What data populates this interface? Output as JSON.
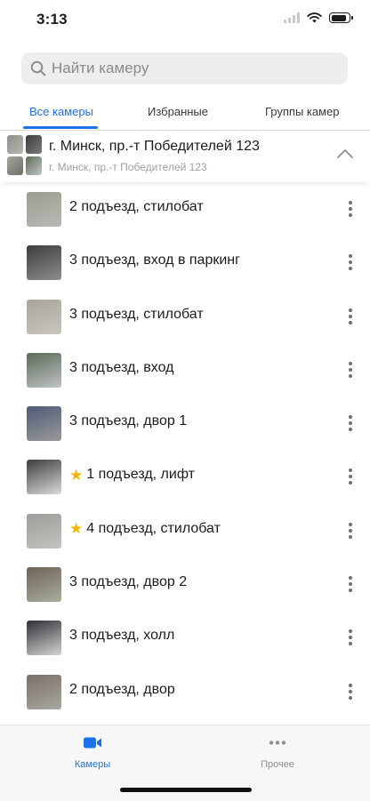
{
  "status_bar": {
    "time": "3:13",
    "battery_level": 0.9
  },
  "search": {
    "placeholder": "Найти камеру",
    "value": ""
  },
  "tabs": [
    {
      "label": "Все камеры",
      "active": true
    },
    {
      "label": "Избранные",
      "active": false
    },
    {
      "label": "Группы камер",
      "active": false
    }
  ],
  "group": {
    "title": "г. Минск, пр.-т Победителей 123",
    "subtitle": "г. Минск, пр.-т Победителей 123",
    "expanded": true
  },
  "cameras": [
    {
      "name": "2 подъезд, стилобат",
      "favorite": false,
      "thumb_colors": [
        "#9b9b94",
        "#b9bab3"
      ]
    },
    {
      "name": "3 подъезд, вход в паркинг",
      "favorite": false,
      "thumb_colors": [
        "#3d3d3f",
        "#8c8d8f"
      ]
    },
    {
      "name": "3 подъезд, стилобат",
      "favorite": false,
      "thumb_colors": [
        "#a8a49c",
        "#c9c6bf"
      ]
    },
    {
      "name": "3 подъезд, вход",
      "favorite": false,
      "thumb_colors": [
        "#5d6a55",
        "#bfc3c6"
      ]
    },
    {
      "name": "3 подъезд, двор 1",
      "favorite": false,
      "thumb_colors": [
        "#4d5a78",
        "#9a9a96"
      ]
    },
    {
      "name": "1 подъезд, лифт",
      "favorite": true,
      "thumb_colors": [
        "#3e3e40",
        "#d9d9d6"
      ]
    },
    {
      "name": "4 подъезд, стилобат",
      "favorite": true,
      "thumb_colors": [
        "#9c9d98",
        "#c3c4bf"
      ]
    },
    {
      "name": "3 подъезд, двор 2",
      "favorite": false,
      "thumb_colors": [
        "#6e6359",
        "#a9ad9c"
      ]
    },
    {
      "name": "3 подъезд, холл",
      "favorite": false,
      "thumb_colors": [
        "#2f3033",
        "#d3d4d6"
      ]
    },
    {
      "name": "2 подъезд, двор",
      "favorite": false,
      "thumb_colors": [
        "#7c6f68",
        "#a6a8a1"
      ]
    }
  ],
  "bottom_nav": [
    {
      "label": "Камеры",
      "icon": "video-camera-icon",
      "active": true
    },
    {
      "label": "Прочее",
      "icon": "more-horizontal-icon",
      "active": false
    }
  ],
  "colors": {
    "accent": "#1a73e8",
    "favorite_star": "#f4b400",
    "inactive_nav": "#8e8e93"
  }
}
